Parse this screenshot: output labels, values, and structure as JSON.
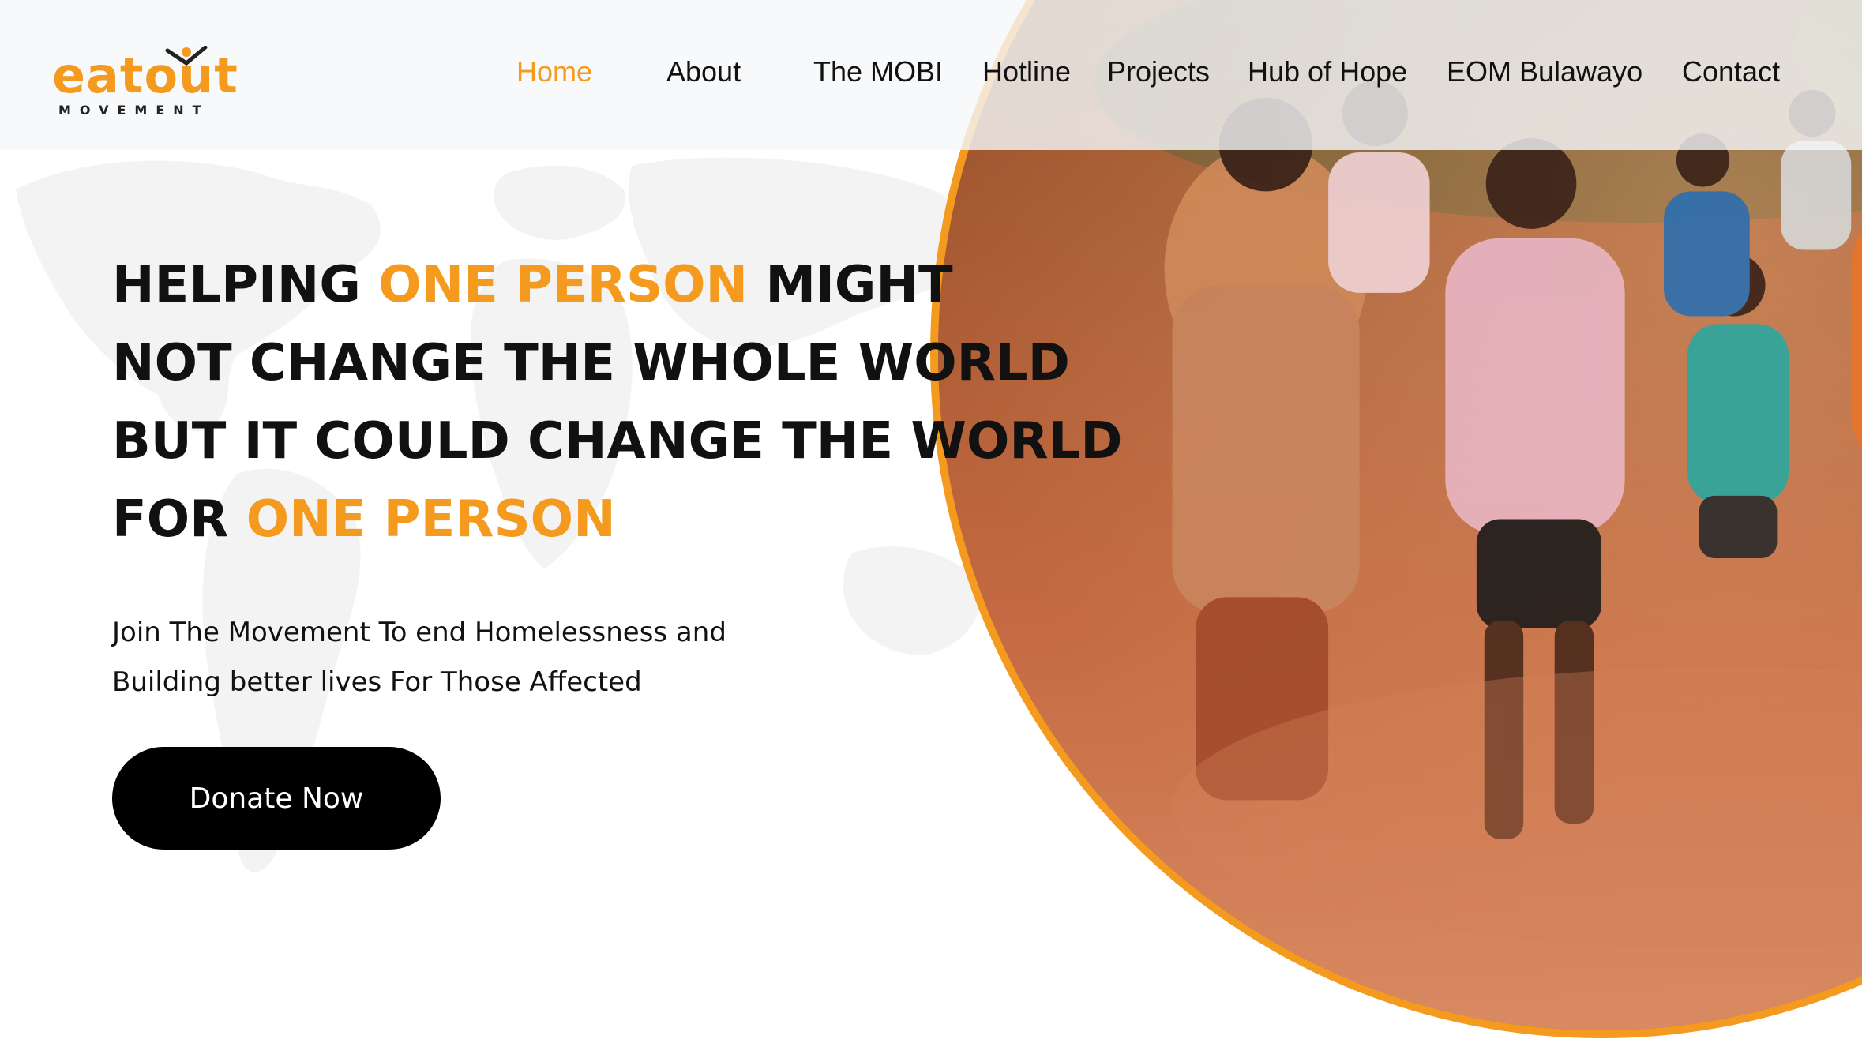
{
  "brand": {
    "logo_text": "eatout",
    "logo_subtext": "MOVEMENT",
    "accent_color": "#f39a1f"
  },
  "nav": {
    "items": [
      {
        "label": "Home",
        "active": true
      },
      {
        "label": "About",
        "active": false
      },
      {
        "label": "The MOBI",
        "active": false
      },
      {
        "label": "Hotline",
        "active": false
      },
      {
        "label": "Projects",
        "active": false
      },
      {
        "label": "Hub of Hope",
        "active": false
      },
      {
        "label": "EOM Bulawayo",
        "active": false
      },
      {
        "label": "Contact",
        "active": false
      }
    ]
  },
  "hero": {
    "headline": {
      "line1_a": "HELPING ",
      "line1_accent": "ONE PERSON",
      "line1_b": " MIGHT",
      "line2": "NOT CHANGE THE WHOLE WORLD",
      "line3": "BUT IT COULD CHANGE THE WORLD",
      "line4_a": "FOR ",
      "line4_accent": "ONE PERSON"
    },
    "subtext_line1": "Join The Movement To end Homelessness and",
    "subtext_line2": "Building better lives For Those Affected",
    "cta_label": "Donate Now",
    "image_alt": "children running on a dirt path",
    "cta_color": "#000000"
  }
}
